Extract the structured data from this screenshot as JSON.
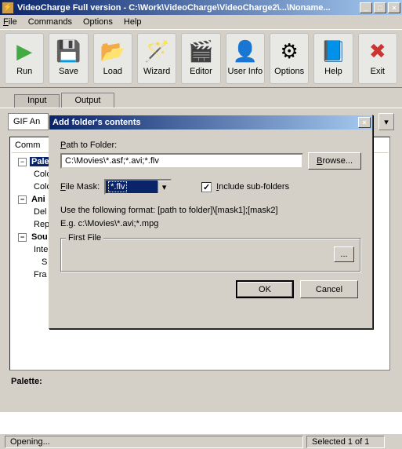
{
  "window": {
    "title": "VideoCharge Full version - C:\\Work\\VideoCharge\\VideoCharge2\\...\\Noname..."
  },
  "menu": {
    "file": "File",
    "commands": "Commands",
    "options": "Options",
    "help": "Help"
  },
  "toolbar": {
    "run": "Run",
    "save": "Save",
    "load": "Load",
    "wizard": "Wizard",
    "editor": "Editor",
    "userinfo": "User Info",
    "options": "Options",
    "help": "Help",
    "exit": "Exit"
  },
  "tabs": {
    "input": "Input",
    "output": "Output"
  },
  "gif_label": "GIF An",
  "tree": {
    "colComment": "Comm",
    "palette": "Palette",
    "colors1": "Colo",
    "colors2": "Colo",
    "ani": "Ani",
    "del": "Del",
    "rep": "Rep",
    "sou": "Sou",
    "inter": "Inte",
    "s": "S",
    "fra": "Fra"
  },
  "palette_label": "Palette:",
  "status": {
    "left": "Opening...",
    "right": "Selected 1 of 1"
  },
  "dialog": {
    "title": "Add folder's contents",
    "path_label": "Path to Folder:",
    "path_value": "C:\\Movies\\*.asf;*.avi;*.flv",
    "browse": "Browse...",
    "mask_label": "File Mask:",
    "mask_value": "*.flv",
    "include": "Include sub-folders",
    "hint1": "Use the following format: [path to folder]\\[mask1];[mask2]",
    "hint2": "E.g. c:\\Movies\\*.avi;*.mpg",
    "first_file": "First File",
    "ellipsis": "...",
    "ok": "OK",
    "cancel": "Cancel"
  }
}
